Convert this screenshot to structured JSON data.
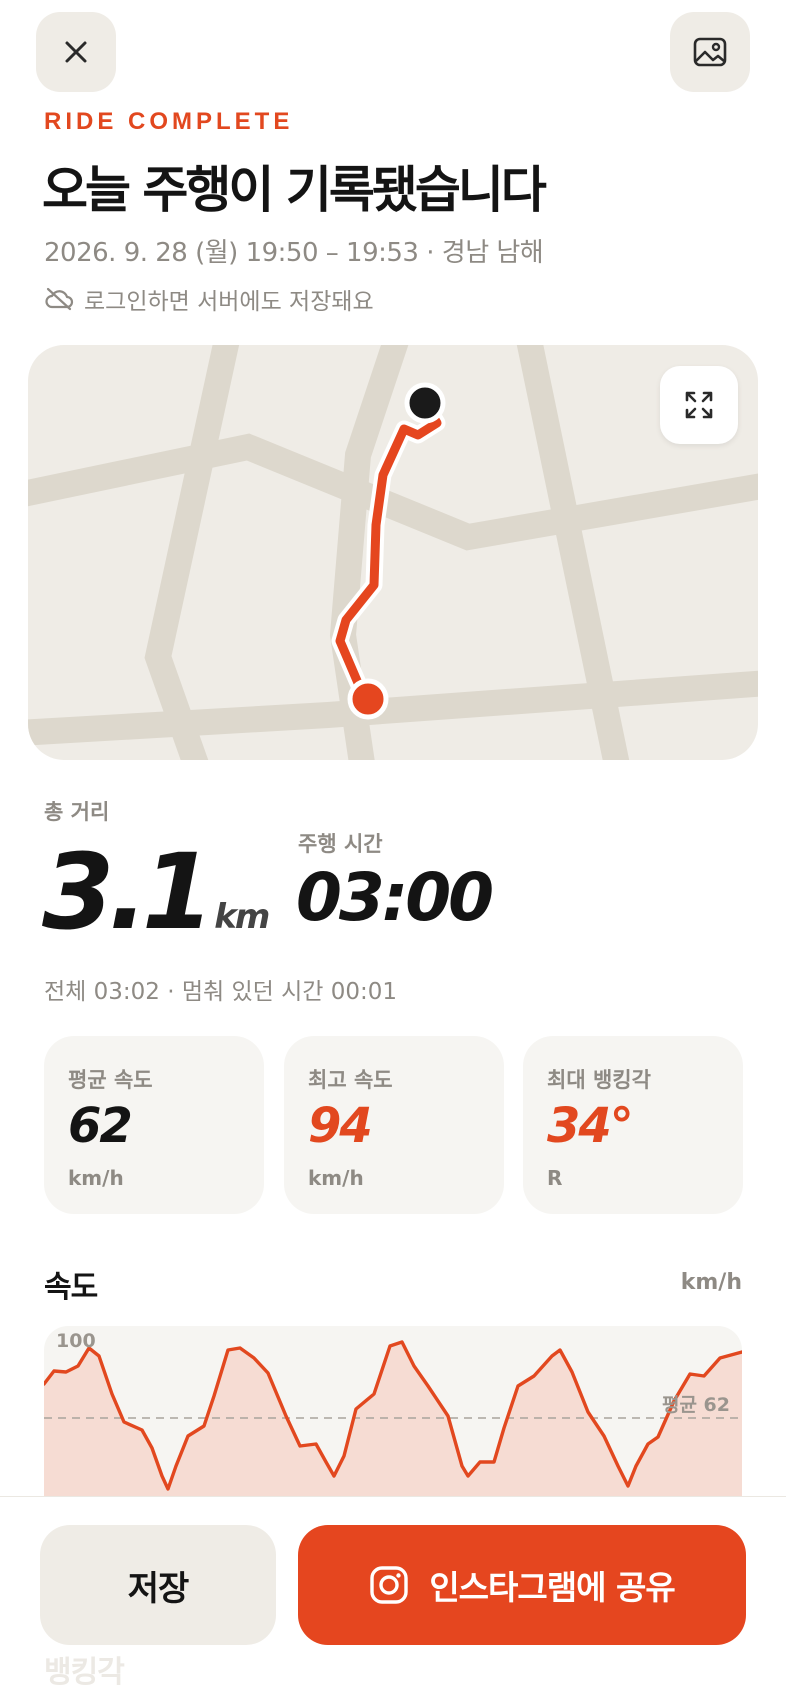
{
  "header": {
    "eyebrow": "RIDE COMPLETE",
    "title": "오늘 주행이 기록됐습니다",
    "ride_meta": "2026. 9. 28 (월) 19:50 – 19:53 · 경남 남해",
    "save_hint": "로그인하면 서버에도 저장돼요",
    "icons": {
      "close": "close-icon",
      "gallery": "image-icon",
      "cloud": "cloud-off-icon"
    }
  },
  "map": {
    "expand_icon": "expand-icon"
  },
  "summary": {
    "distance_label": "총 거리",
    "distance_value": "3.1",
    "distance_unit": "km",
    "duration_label": "주행 시간",
    "duration_value": "03:00",
    "total_line": "전체 03:02 · 멈춰 있던 시간 00:01"
  },
  "stats": [
    {
      "label": "평균 속도",
      "value": "62",
      "unit": "km/h",
      "color": "#141414"
    },
    {
      "label": "최고 속도",
      "value": "94",
      "unit": "km/h",
      "color": "#e2481f"
    },
    {
      "label": "최대 뱅킹각",
      "value": "34°",
      "unit": "R",
      "color": "#e2481f"
    }
  ],
  "speed_chart": {
    "title": "속도",
    "unit": "km/h",
    "max_label": "100",
    "avg_label": "평균 62",
    "avg_value": 62,
    "max_value": 100,
    "line_color": "#e2481f",
    "fill_color": "#f6dcd3"
  },
  "bottom": {
    "next_heading": "뱅킹각",
    "save_label": "저장",
    "share_label": "인스타그램에 공유",
    "share_icon": "instagram-icon"
  },
  "colors": {
    "accent": "#e2481f",
    "muted": "#8e8a84",
    "surface": "#efece6"
  }
}
